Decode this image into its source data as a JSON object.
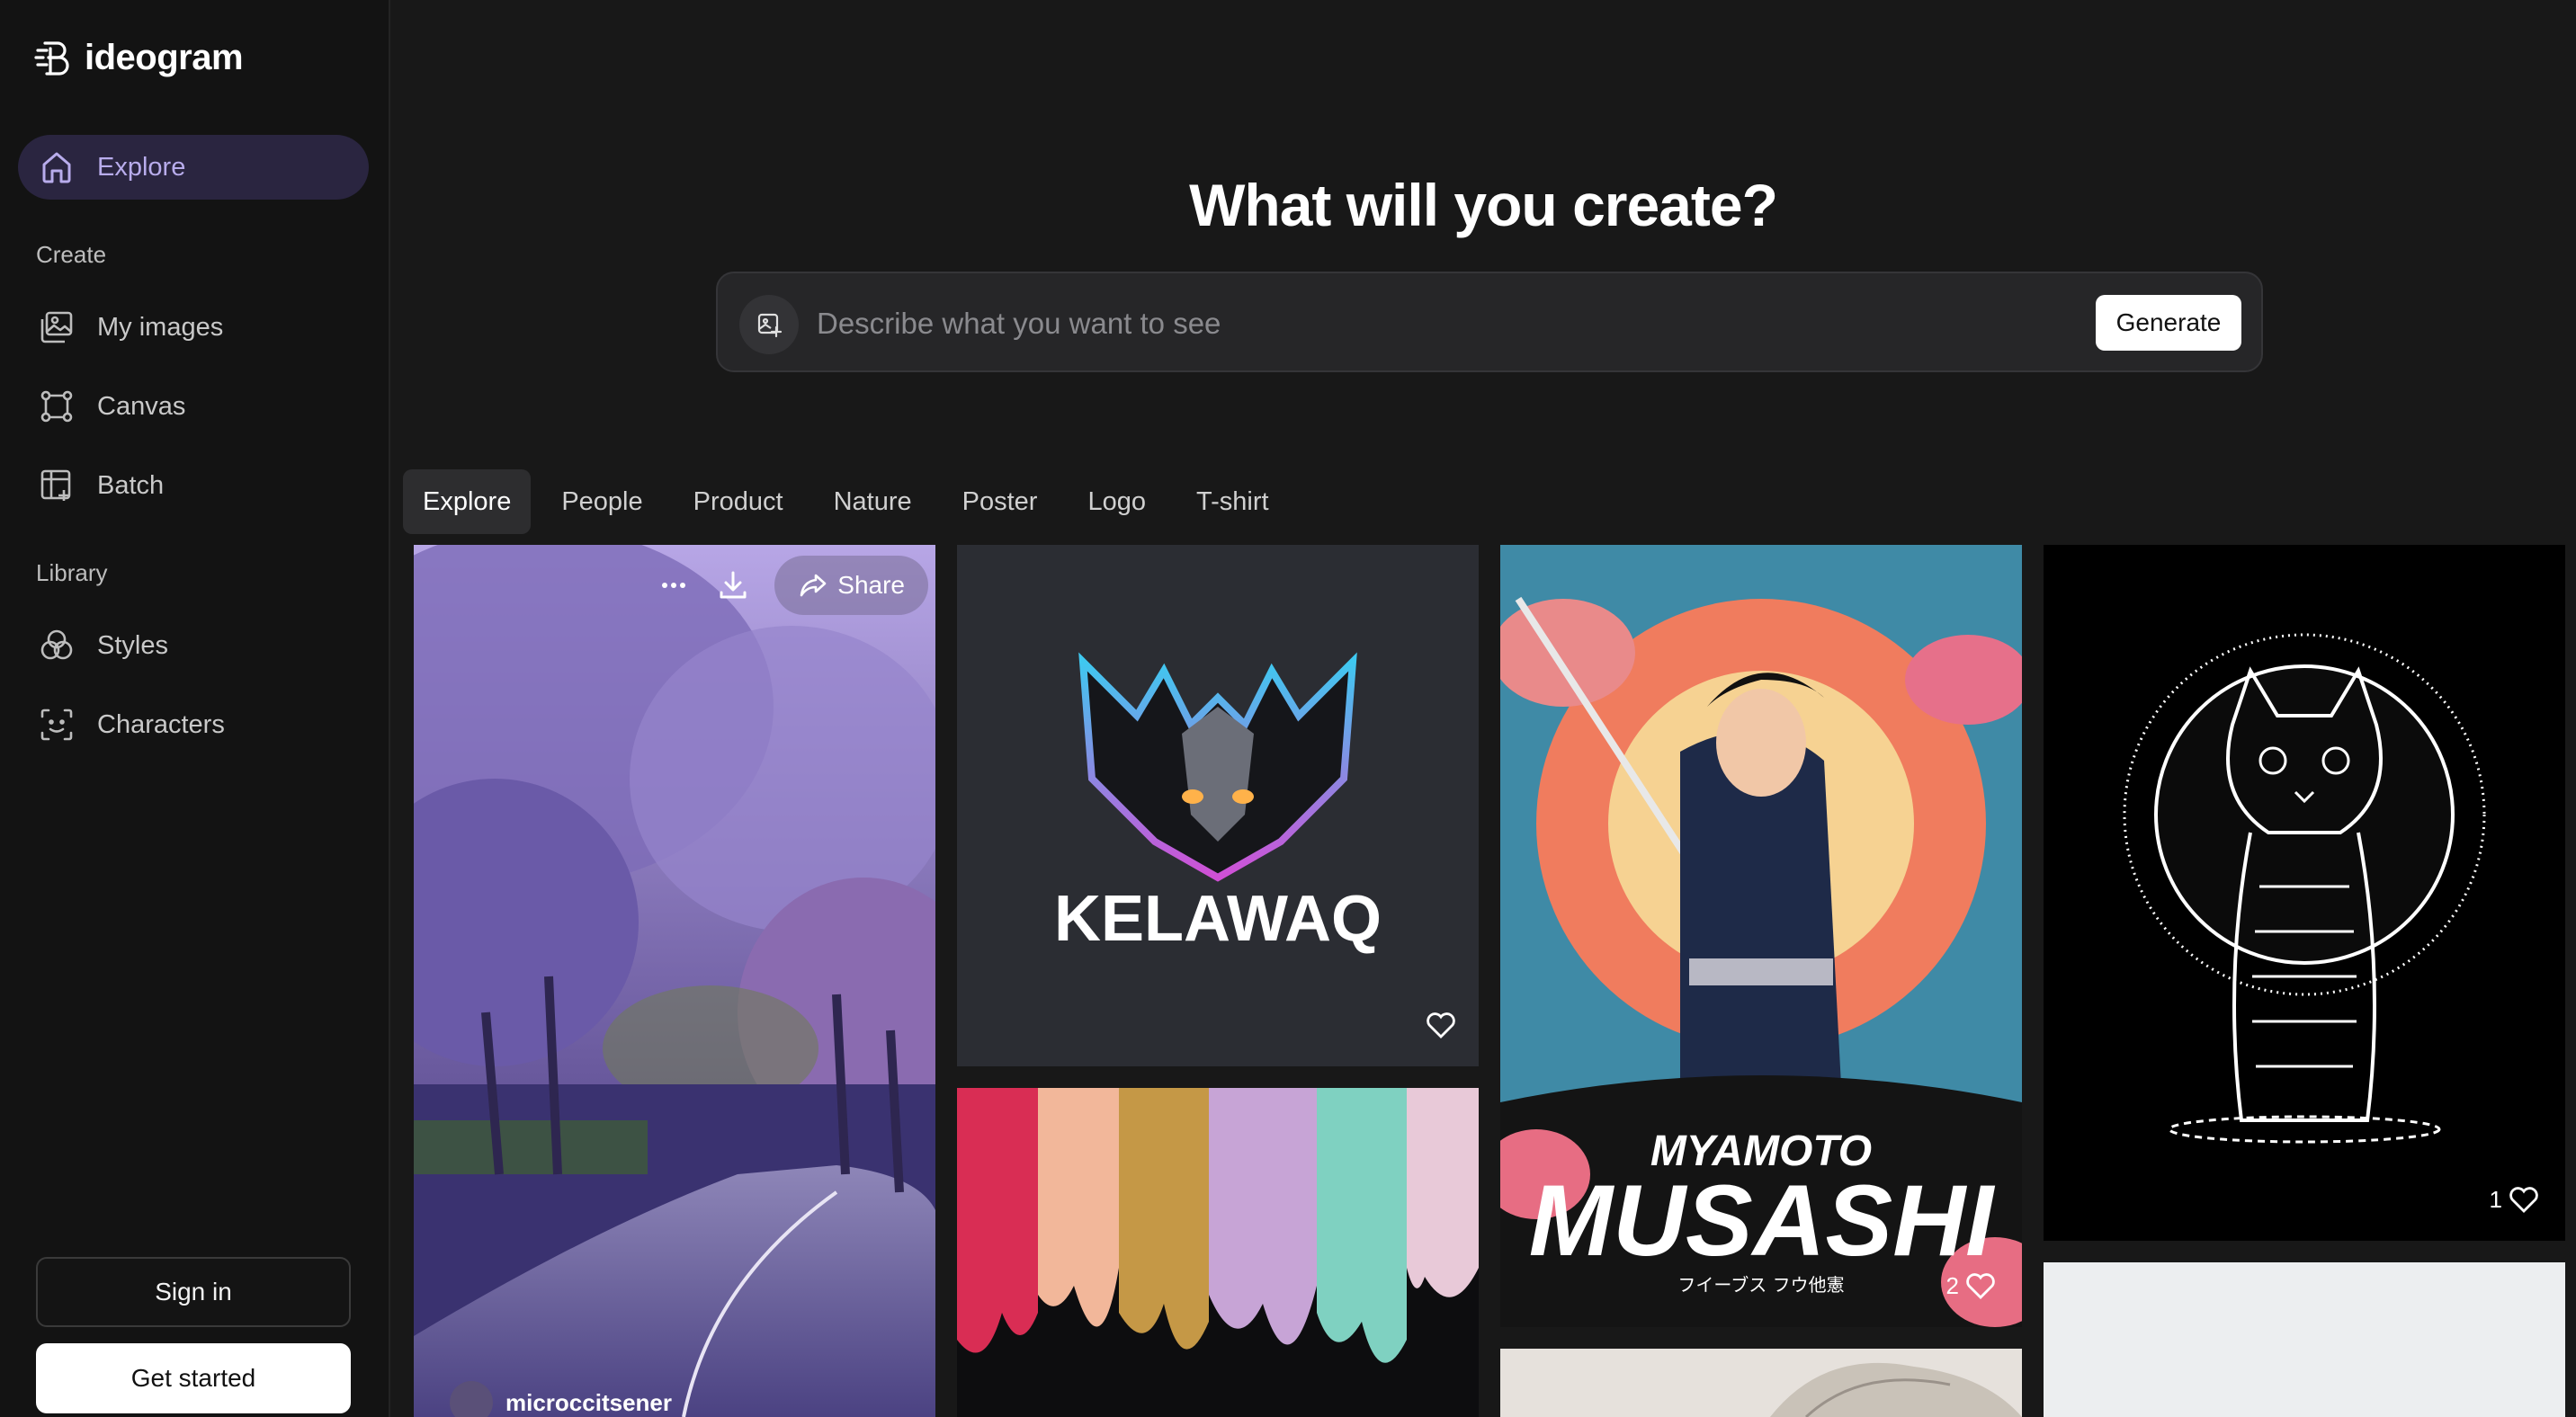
{
  "brand": {
    "name": "ideogram"
  },
  "sidebar": {
    "explore_label": "Explore",
    "create_section": "Create",
    "create_items": [
      {
        "label": "My images",
        "icon": "images-icon"
      },
      {
        "label": "Canvas",
        "icon": "canvas-icon"
      },
      {
        "label": "Batch",
        "icon": "batch-icon"
      }
    ],
    "library_section": "Library",
    "library_items": [
      {
        "label": "Styles",
        "icon": "styles-icon"
      },
      {
        "label": "Characters",
        "icon": "characters-icon"
      }
    ],
    "signin_label": "Sign in",
    "getstarted_label": "Get started"
  },
  "hero": {
    "title": "What will you create?",
    "placeholder": "Describe what you want to see",
    "generate_label": "Generate"
  },
  "tabs": [
    "Explore",
    "People",
    "Product",
    "Nature",
    "Poster",
    "Logo",
    "T-shirt"
  ],
  "active_tab": "Explore",
  "gallery": {
    "card1": {
      "share_label": "Share",
      "user": "microccitsener"
    },
    "card2": {
      "logo_text": "KELAWAQ"
    },
    "card4": {
      "title_top": "MYAMOTO",
      "title_main": "MUSASHI",
      "subtitle": "フイーブス フウ他憲",
      "likes": "2"
    },
    "card5": {
      "likes": "1"
    }
  },
  "colors": {
    "accent": "#b8acec",
    "active_nav_bg": "#2a2540",
    "background": "#181818"
  }
}
